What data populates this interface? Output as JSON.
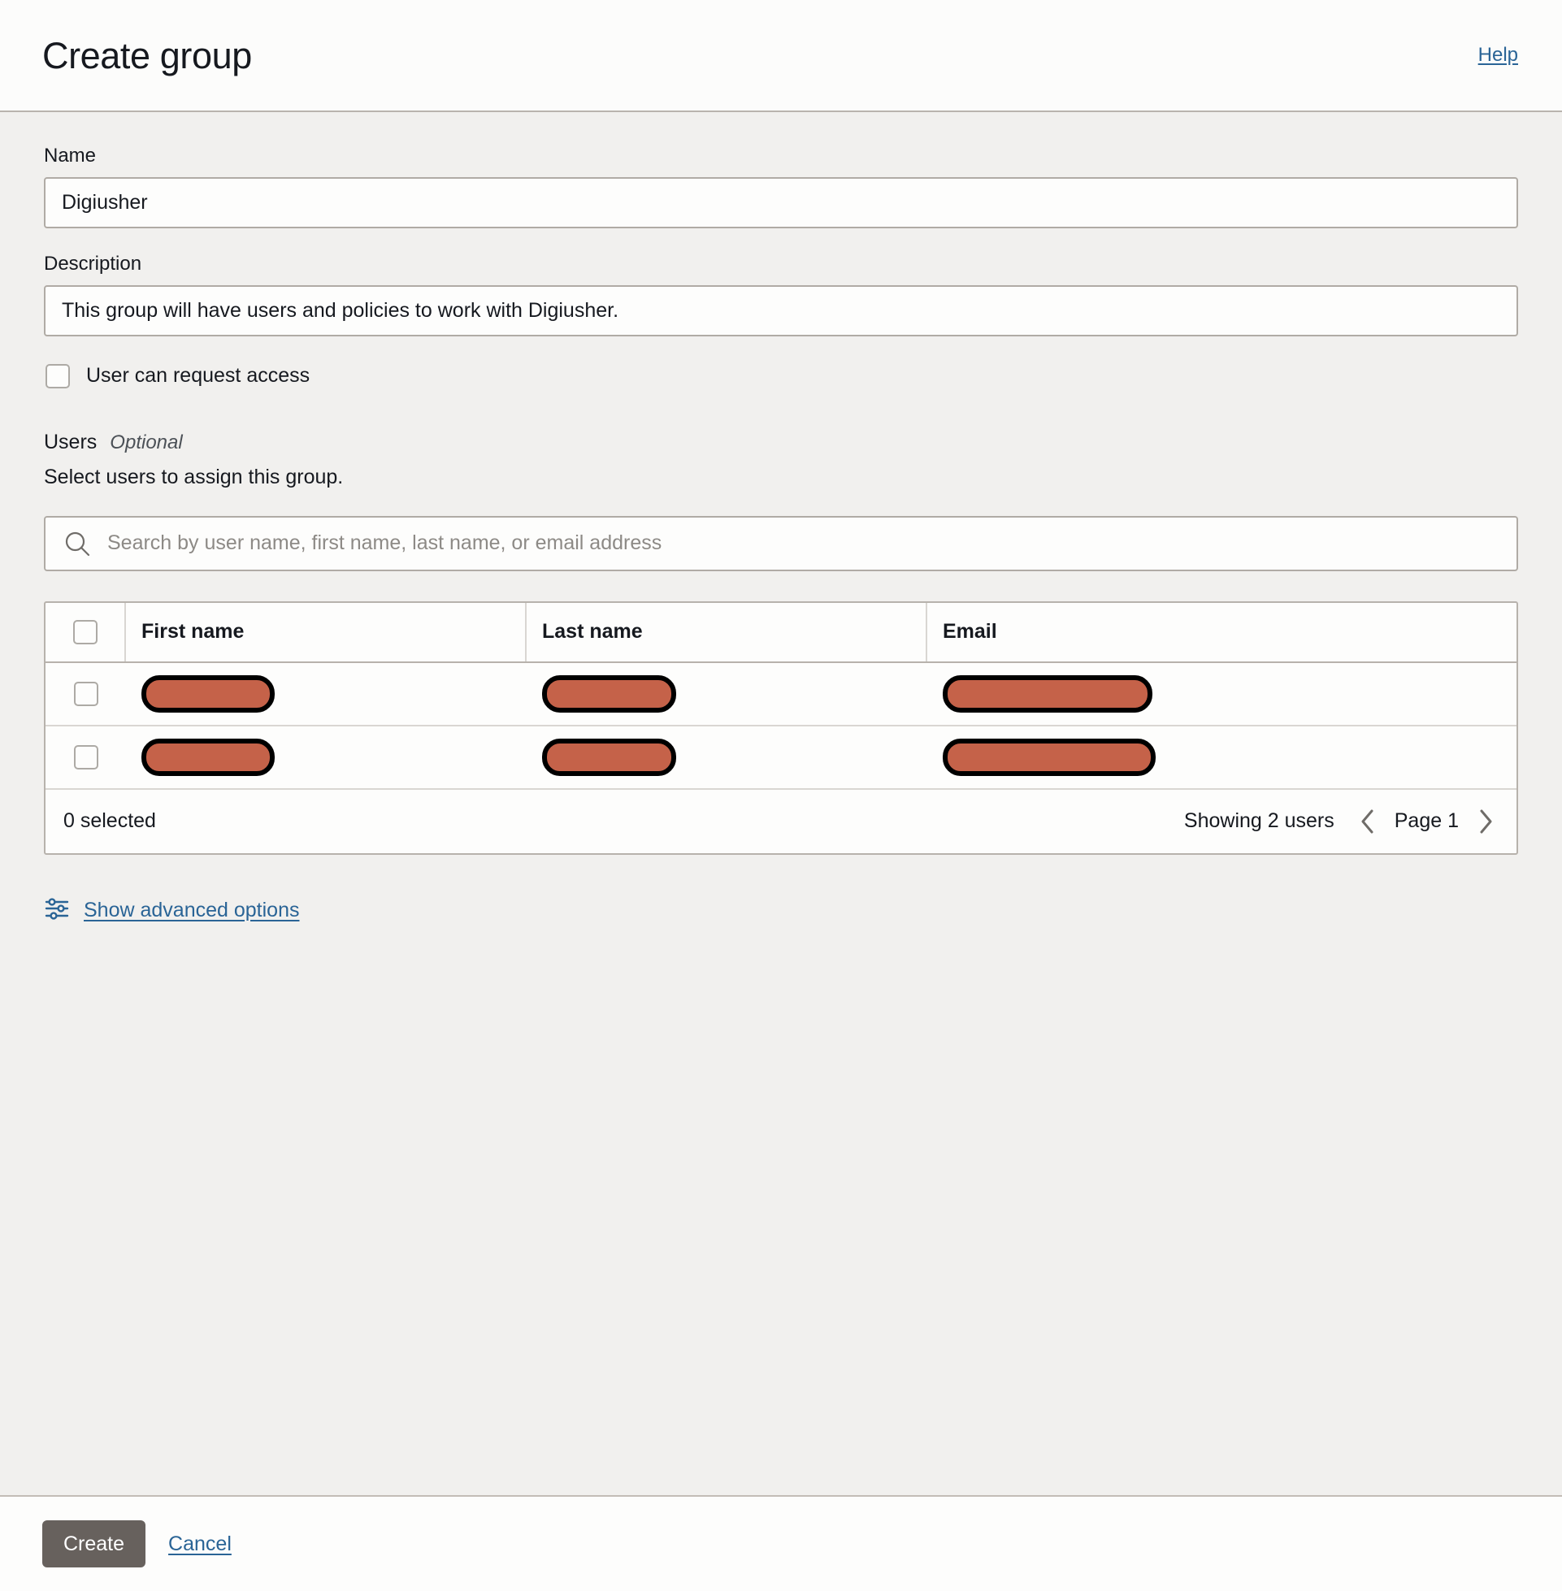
{
  "header": {
    "title": "Create group",
    "help_label": "Help"
  },
  "form": {
    "name_label": "Name",
    "name_value": "Digiusher",
    "name_placeholder": "",
    "description_label": "Description",
    "description_value": "This group will have users and policies to work with Digiusher.",
    "description_placeholder": "",
    "request_access_label": "User can request access",
    "request_access_checked": false
  },
  "users": {
    "title": "Users",
    "optional_label": "Optional",
    "subtitle": "Select users to assign this group.",
    "search_placeholder": "Search by user name, first name, last name, or email address",
    "search_value": "",
    "search_icon": "search-icon",
    "columns": [
      "First name",
      "Last name",
      "Email"
    ],
    "rows": [
      {
        "first_name": "",
        "last_name": "",
        "email": "",
        "redacted": true,
        "selected": false
      },
      {
        "first_name": "",
        "last_name": "",
        "email": "",
        "redacted": true,
        "selected": false
      }
    ],
    "selected_text": "0 selected",
    "showing_text": "Showing 2 users",
    "page_label": "Page 1",
    "prev_icon": "chevron-left-icon",
    "next_icon": "chevron-right-icon"
  },
  "advanced": {
    "icon": "sliders-icon",
    "label": "Show advanced options"
  },
  "footer": {
    "create_label": "Create",
    "cancel_label": "Cancel"
  },
  "colors": {
    "page_background": "#f1f0ee",
    "surface": "#fdfdfc",
    "link": "#2a6496",
    "primary_button": "#67615d",
    "redaction_fill": "#c56249",
    "redaction_stroke": "#000000",
    "border": "#b0aba5",
    "text": "#16191f"
  }
}
